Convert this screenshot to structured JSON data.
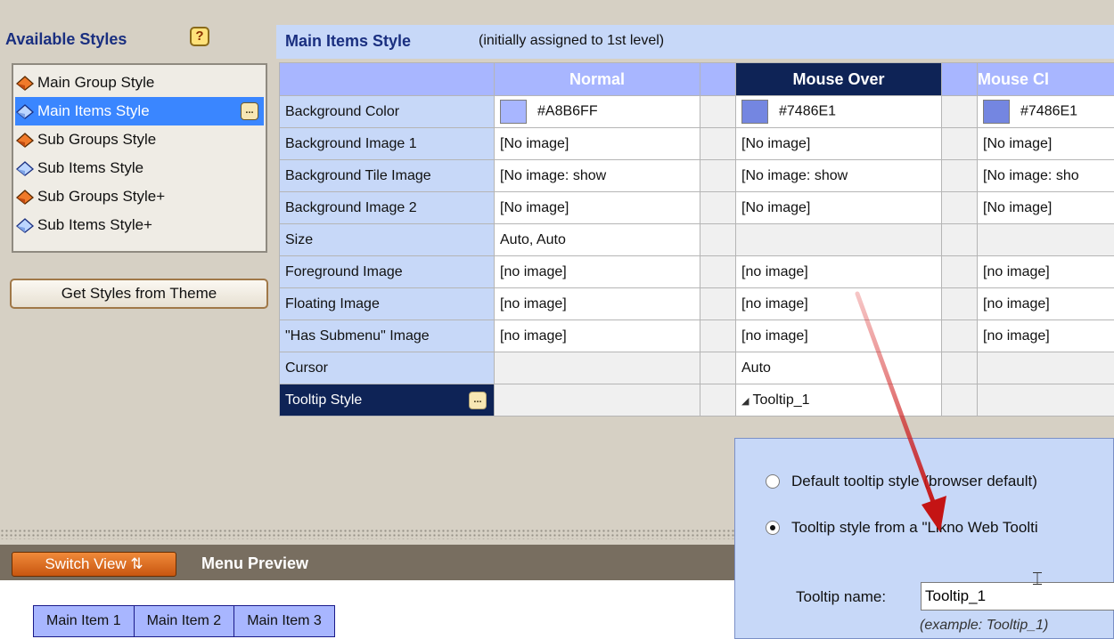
{
  "available_styles": {
    "title": "Available Styles",
    "help_label": "?",
    "items": [
      {
        "label": "Main Group Style",
        "icon": "group-style-icon",
        "selected": false
      },
      {
        "label": "Main Items Style",
        "icon": "item-style-icon",
        "selected": true
      },
      {
        "label": "Sub Groups Style",
        "icon": "group-style-icon",
        "selected": false
      },
      {
        "label": "Sub Items Style",
        "icon": "item-style-icon",
        "selected": false
      },
      {
        "label": "Sub Groups Style+",
        "icon": "group-style-icon",
        "selected": false
      },
      {
        "label": "Sub Items Style+",
        "icon": "item-style-icon",
        "selected": false
      }
    ],
    "more_label": "...",
    "get_styles_button": "Get Styles from Theme"
  },
  "main": {
    "title": "Main Items Style",
    "subtitle": "(initially assigned to 1st level)",
    "columns": [
      "Normal",
      "Mouse Over",
      "Mouse Cl"
    ],
    "rows": [
      {
        "label": "Background Color",
        "normal": "#A8B6FF",
        "mouse_over": "#7486E1",
        "mouse_click": "#7486E1"
      },
      {
        "label": "Background Image 1",
        "normal": "[No image]",
        "mouse_over": "[No image]",
        "mouse_click": "[No image]"
      },
      {
        "label": "Background Tile Image",
        "normal": "[No image: show",
        "mouse_over": "[No image: show",
        "mouse_click": "[No image: sho"
      },
      {
        "label": "Background Image 2",
        "normal": "[No image]",
        "mouse_over": "[No image]",
        "mouse_click": "[No image]"
      },
      {
        "label": "Size",
        "normal": "Auto, Auto",
        "mouse_over": "",
        "mouse_click": ""
      },
      {
        "label": "Foreground Image",
        "normal": "[no image]",
        "mouse_over": "[no image]",
        "mouse_click": "[no image]"
      },
      {
        "label": "Floating Image",
        "normal": "[no image]",
        "mouse_over": "[no image]",
        "mouse_click": "[no image]"
      },
      {
        "label": "\"Has Submenu\" Image",
        "normal": "[no image]",
        "mouse_over": "[no image]",
        "mouse_click": "[no image]"
      },
      {
        "label": "Cursor",
        "normal": "",
        "mouse_over": "Auto",
        "mouse_click": ""
      },
      {
        "label": "Tooltip Style",
        "normal": "",
        "mouse_over": "Tooltip_1",
        "mouse_click": ""
      }
    ],
    "colors": {
      "normal_bg": "#A8B6FF",
      "mouse_over_bg": "#7486E1",
      "mouse_click_bg": "#7486E1",
      "header_selected": "#0E2356"
    }
  },
  "preview": {
    "switch_button": "Switch View ⇅",
    "title": "Menu Preview",
    "items": [
      "Main Item 1",
      "Main Item 2",
      "Main Item 3"
    ]
  },
  "tooltip_popup": {
    "option_default": "Default tooltip style  (browser default)",
    "option_likno": "Tooltip style from a \"Likno Web Toolti",
    "name_label": "Tooltip name:",
    "name_value": "Tooltip_1",
    "example": "(example: Tooltip_1)"
  }
}
